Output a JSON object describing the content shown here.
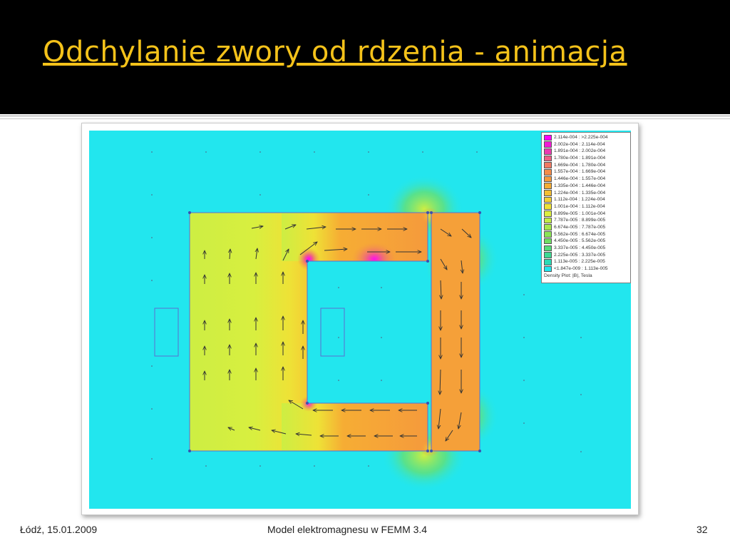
{
  "slide": {
    "title": "Odchylanie zwory od rdzenia - animacja",
    "footer_left": "Łódź, 15.01.2009",
    "footer_center": "Model elektromagnesu w FEMM 3.4",
    "footer_right": "32"
  },
  "colors": {
    "title": "#f4c21a",
    "background_field": "#22e6ee",
    "core_high": "#f59a3c",
    "core_medium": "#f2c33a",
    "core_low": "#cdee43"
  },
  "legend": {
    "entries": [
      {
        "label": "2.114e-004 : >2.225e-004",
        "color": "#ff00ff"
      },
      {
        "label": "2.002e-004 : 2.114e-004",
        "color": "#f31bd6"
      },
      {
        "label": "1.891e-004 : 2.002e-004",
        "color": "#ea3ab2"
      },
      {
        "label": "1.780e-004 : 1.891e-004",
        "color": "#ee5f86"
      },
      {
        "label": "1.669e-004 : 1.780e-004",
        "color": "#f27a62"
      },
      {
        "label": "1.557e-004 : 1.669e-004",
        "color": "#f48c4a"
      },
      {
        "label": "1.446e-004 : 1.557e-004",
        "color": "#f59a3c"
      },
      {
        "label": "1.335e-004 : 1.446e-004",
        "color": "#f6ad34"
      },
      {
        "label": "1.224e-004 : 1.335e-004",
        "color": "#f4be33"
      },
      {
        "label": "1.112e-004 : 1.224e-004",
        "color": "#f3d034"
      },
      {
        "label": "1.001e-004 : 1.112e-004",
        "color": "#eee236"
      },
      {
        "label": "8.899e-005 : 1.001e-004",
        "color": "#dcee3e"
      },
      {
        "label": "7.787e-005 : 8.899e-005",
        "color": "#c3ec46"
      },
      {
        "label": "6.674e-005 : 7.787e-005",
        "color": "#a6e84d"
      },
      {
        "label": "5.562e-005 : 6.674e-005",
        "color": "#8ae455"
      },
      {
        "label": "4.450e-005 : 5.562e-005",
        "color": "#6fdf62"
      },
      {
        "label": "3.337e-005 : 4.450e-005",
        "color": "#55dc78"
      },
      {
        "label": "2.225e-005 : 3.337e-005",
        "color": "#3ed994"
      },
      {
        "label": "1.113e-005 : 2.225e-005",
        "color": "#2cdbb6"
      },
      {
        "label": "<1.847e-009 : 1.113e-005",
        "color": "#22e6ee"
      }
    ],
    "caption": "Density Plot: |B|, Tesla"
  }
}
